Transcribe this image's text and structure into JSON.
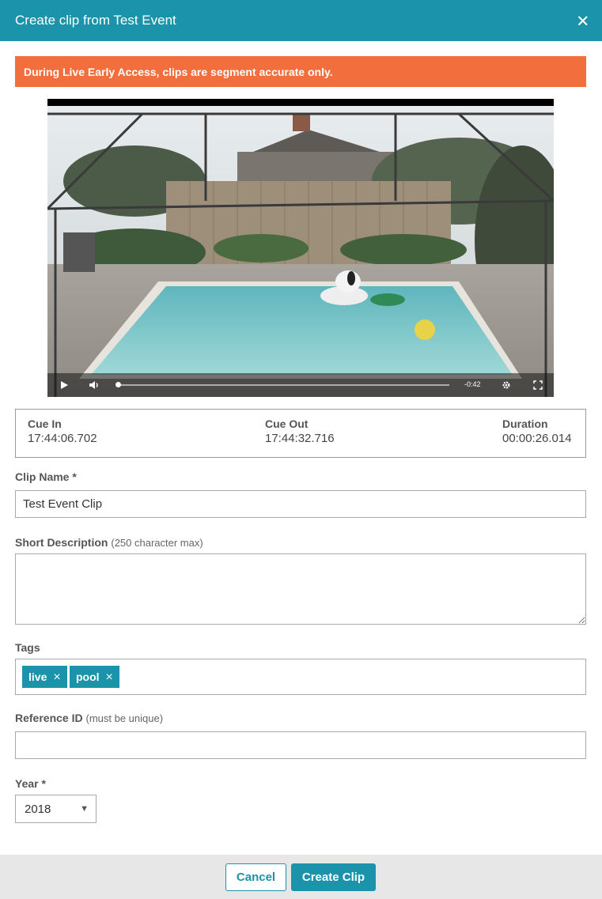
{
  "dialog": {
    "title": "Create clip from Test Event"
  },
  "alert": {
    "text": "During Live Early Access, clips are segment accurate only."
  },
  "player": {
    "time_remaining": "-0:42",
    "progress": 0.0
  },
  "cue": {
    "cue_in_label": "Cue In",
    "cue_in_value": "17:44:06.702",
    "cue_out_label": "Cue Out",
    "cue_out_value": "17:44:32.716",
    "duration_label": "Duration",
    "duration_value": "00:00:26.014"
  },
  "clip_name": {
    "label": "Clip Name *",
    "value": "Test Event Clip"
  },
  "short_description": {
    "label": "Short Description",
    "hint": "(250 character max)",
    "value": ""
  },
  "tags": {
    "label": "Tags",
    "items": [
      {
        "label": "live",
        "remove": "×"
      },
      {
        "label": "pool",
        "remove": "×"
      }
    ]
  },
  "reference_id": {
    "label": "Reference ID",
    "hint": "(must be unique)",
    "value": ""
  },
  "year": {
    "label": "Year *",
    "value": "2018",
    "arrow": "▼"
  },
  "footer": {
    "cancel_label": "Cancel",
    "create_label": "Create Clip"
  },
  "colors": {
    "header": "#1a93ab",
    "alert": "#f26f3d",
    "tag": "#1a93ab",
    "primary_button": "#1a93ab",
    "footer": "#e7e7e7"
  },
  "icons": {
    "close": "close-icon",
    "play": "play-icon",
    "volume": "volume-icon",
    "settings": "gear-icon",
    "fullscreen": "fullscreen-icon",
    "tag_remove": "close-icon",
    "select": "chevron-down-icon"
  }
}
